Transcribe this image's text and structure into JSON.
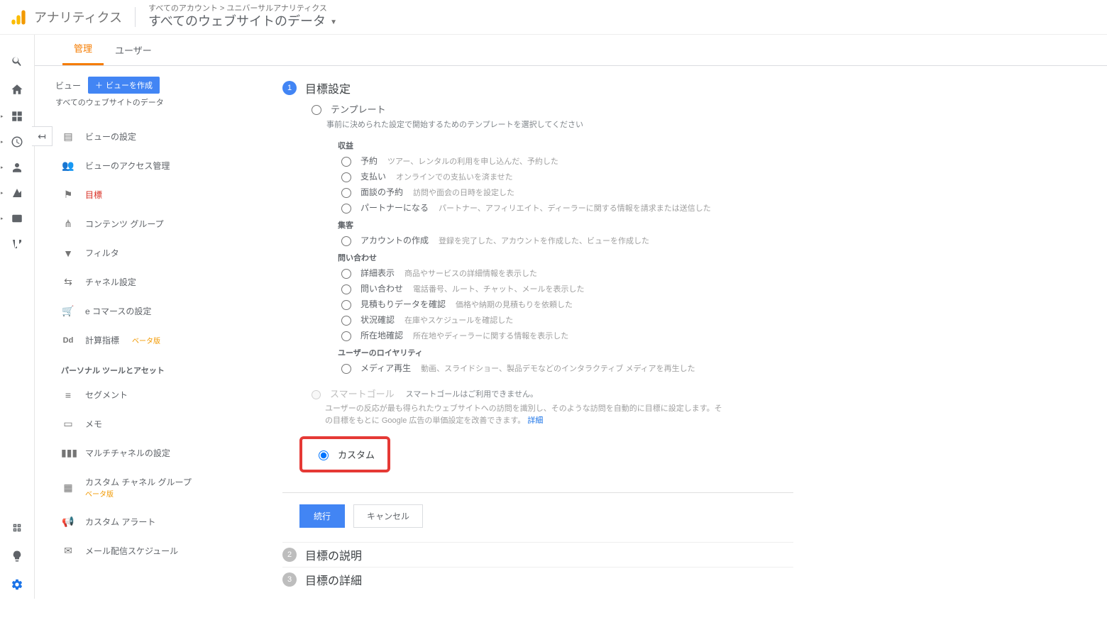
{
  "header": {
    "product_name": "アナリティクス",
    "breadcrumb": "すべてのアカウント > ユニバーサルアナリティクス",
    "property_name": "すべてのウェブサイトのデータ"
  },
  "tabs": {
    "admin": "管理",
    "user": "ユーザー"
  },
  "admin": {
    "view_label": "ビュー",
    "create_view": "ビューを作成",
    "view_name": "すべてのウェブサイトのデータ",
    "items": {
      "view_settings": "ビューの設定",
      "access": "ビューのアクセス管理",
      "goals": "目標",
      "content_groups": "コンテンツ グループ",
      "filters": "フィルタ",
      "channel": "チャネル設定",
      "ecommerce": "e コマースの設定",
      "calc_metrics": "計算指標",
      "calc_metrics_beta": "ベータ版"
    },
    "section_personal": "パーソナル ツールとアセット",
    "personal": {
      "segments": "セグメント",
      "notes": "メモ",
      "mcf": "マルチチャネルの設定",
      "custom_channel": "カスタム チャネル グループ",
      "custom_channel_beta": "ベータ版",
      "alerts": "カスタム アラート",
      "mail": "メール配信スケジュール"
    }
  },
  "goal": {
    "step1_title": "目標設定",
    "template_label": "テンプレート",
    "template_hint": "事前に決められた設定で開始するためのテンプレートを選択してください",
    "groups": {
      "revenue": {
        "title": "収益",
        "reservation": {
          "label": "予約",
          "desc": "ツアー、レンタルの利用を申し込んだ、予約した"
        },
        "payment": {
          "label": "支払い",
          "desc": "オンラインでの支払いを済ませた"
        },
        "appointment": {
          "label": "面談の予約",
          "desc": "訪問や面会の日時を設定した"
        },
        "partner": {
          "label": "パートナーになる",
          "desc": "パートナー、アフィリエイト、ディーラーに関する情報を請求または送信した"
        }
      },
      "acquisition": {
        "title": "集客",
        "create_account": {
          "label": "アカウントの作成",
          "desc": "登録を完了した、アカウントを作成した、ビューを作成した"
        }
      },
      "inquiry": {
        "title": "問い合わせ",
        "detail": {
          "label": "詳細表示",
          "desc": "商品やサービスの詳細情報を表示した"
        },
        "contact": {
          "label": "問い合わせ",
          "desc": "電話番号、ルート、チャット、メールを表示した"
        },
        "estimate": {
          "label": "見積もりデータを確認",
          "desc": "価格や納期の見積もりを依頼した"
        },
        "status": {
          "label": "状況確認",
          "desc": "在庫やスケジュールを確認した"
        },
        "location": {
          "label": "所在地確認",
          "desc": "所在地やディーラーに関する情報を表示した"
        }
      },
      "loyalty": {
        "title": "ユーザーのロイヤリティ",
        "media": {
          "label": "メディア再生",
          "desc": "動画、スライドショー、製品デモなどのインタラクティブ メディアを再生した"
        }
      }
    },
    "smart": {
      "label": "スマートゴール",
      "unavail": "スマートゴールはご利用できません。",
      "hint": "ユーザーの反応が最も得られたウェブサイトへの訪問を識別し、そのような訪問を自動的に目標に設定します。その目標をもとに Google 広告の単価設定を改善できます。",
      "link": "詳細"
    },
    "custom_label": "カスタム",
    "continue": "続行",
    "cancel": "キャンセル",
    "step2_title": "目標の説明",
    "step3_title": "目標の詳細"
  }
}
